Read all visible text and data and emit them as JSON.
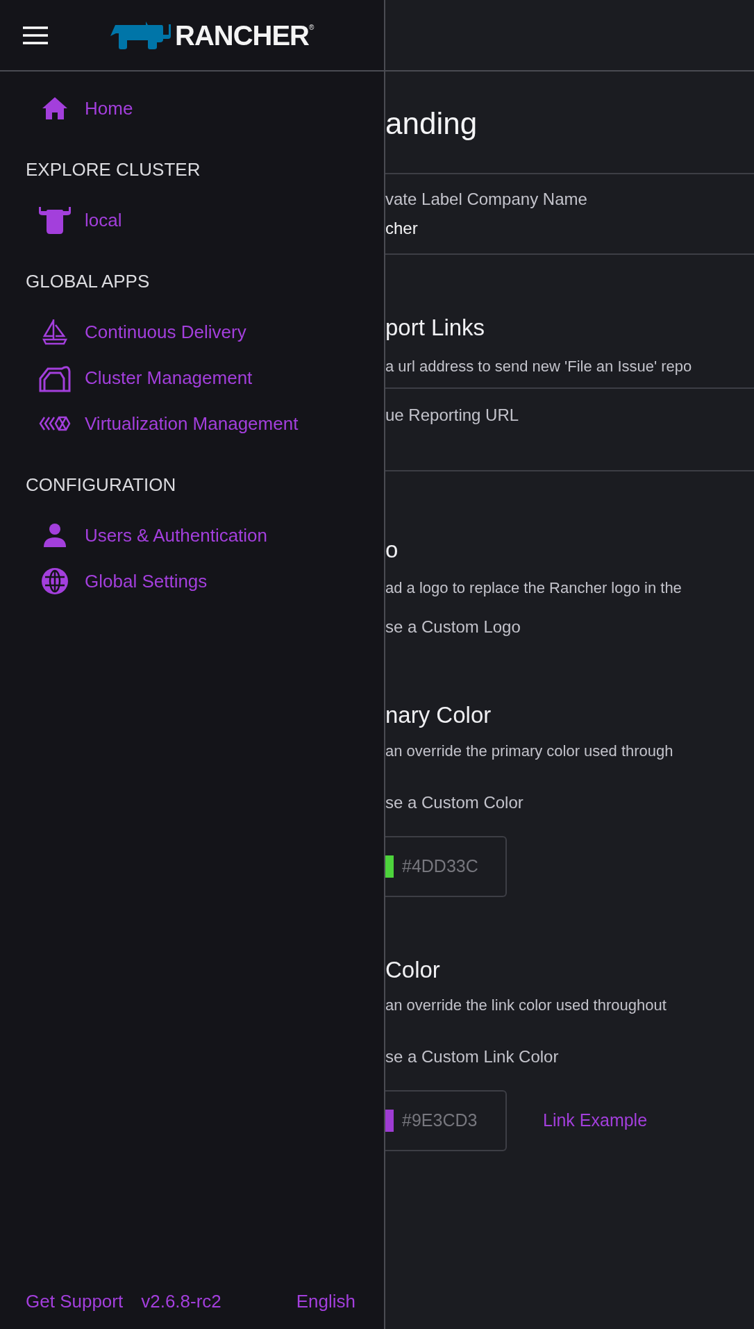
{
  "header": {
    "logo_text": "RANCHER",
    "logo_mark": "®"
  },
  "sidebar": {
    "home": {
      "label": "Home",
      "kind": "home"
    },
    "sections": [
      {
        "title": "EXPLORE CLUSTER",
        "items": [
          {
            "label": "local",
            "kind": "bull"
          }
        ]
      },
      {
        "title": "GLOBAL APPS",
        "items": [
          {
            "label": "Continuous Delivery",
            "kind": "boat"
          },
          {
            "label": "Cluster Management",
            "kind": "barn"
          },
          {
            "label": "Virtualization Management",
            "kind": "harvester"
          }
        ]
      },
      {
        "title": "CONFIGURATION",
        "items": [
          {
            "label": "Users & Authentication",
            "kind": "user"
          },
          {
            "label": "Global Settings",
            "kind": "globe"
          }
        ]
      }
    ],
    "footer": {
      "support": "Get Support",
      "version": "v2.6.8-rc2",
      "language": "English"
    }
  },
  "main": {
    "title": "anding",
    "company": {
      "label": "vate Label Company Name",
      "value": "cher"
    },
    "support_links": {
      "heading": "port Links",
      "description": "a url address to send new 'File an Issue' repo",
      "field_label": "ue Reporting URL"
    },
    "logo": {
      "heading": "o",
      "description": "ad a logo to replace the Rancher logo in the",
      "checkbox_label": "se a Custom Logo"
    },
    "primary_color": {
      "heading": "nary Color",
      "description": "an override the primary color used through",
      "checkbox_label": "se a Custom Color",
      "value": "#4DD33C",
      "color": "#4dd33c",
      "disabled": true
    },
    "link_color": {
      "heading": "Color",
      "description": "an override the link color used throughout",
      "checkbox_label": "se a Custom Link Color",
      "value": "#9E3CD3",
      "color": "#9e3cd3",
      "disabled": true,
      "example": "Link Example"
    }
  }
}
